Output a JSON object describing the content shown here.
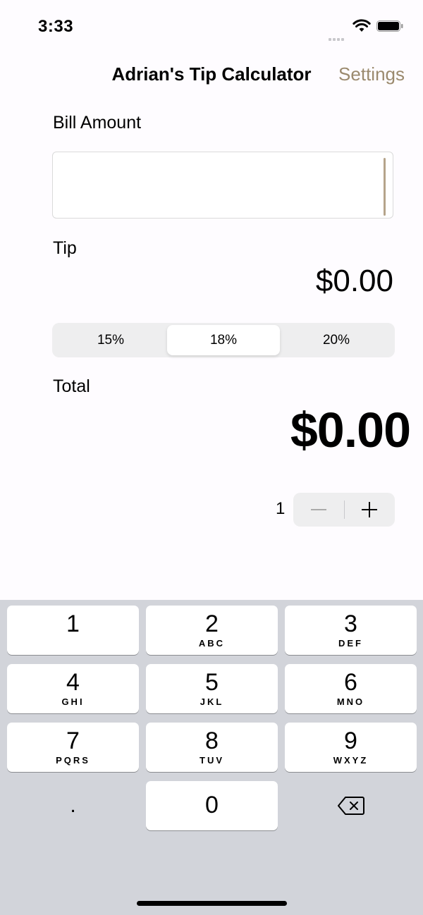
{
  "status_bar": {
    "time": "3:33"
  },
  "nav": {
    "title": "Adrian's Tip Calculator",
    "settings_label": "Settings"
  },
  "bill": {
    "label": "Bill Amount",
    "value": ""
  },
  "tip": {
    "label": "Tip",
    "amount": "$0.00"
  },
  "tip_options": {
    "items": [
      "15%",
      "18%",
      "20%"
    ],
    "selected": "18%"
  },
  "total": {
    "label": "Total",
    "amount": "$0.00"
  },
  "party": {
    "count": "1"
  },
  "keypad": {
    "keys": [
      {
        "num": "1",
        "letters": ""
      },
      {
        "num": "2",
        "letters": "ABC"
      },
      {
        "num": "3",
        "letters": "DEF"
      },
      {
        "num": "4",
        "letters": "GHI"
      },
      {
        "num": "5",
        "letters": "JKL"
      },
      {
        "num": "6",
        "letters": "MNO"
      },
      {
        "num": "7",
        "letters": "PQRS"
      },
      {
        "num": "8",
        "letters": "TUV"
      },
      {
        "num": "9",
        "letters": "WXYZ"
      }
    ],
    "decimal": ".",
    "zero": "0"
  },
  "colors": {
    "accent": "#9b8a6e",
    "keyboard_bg": "#d2d4da"
  }
}
